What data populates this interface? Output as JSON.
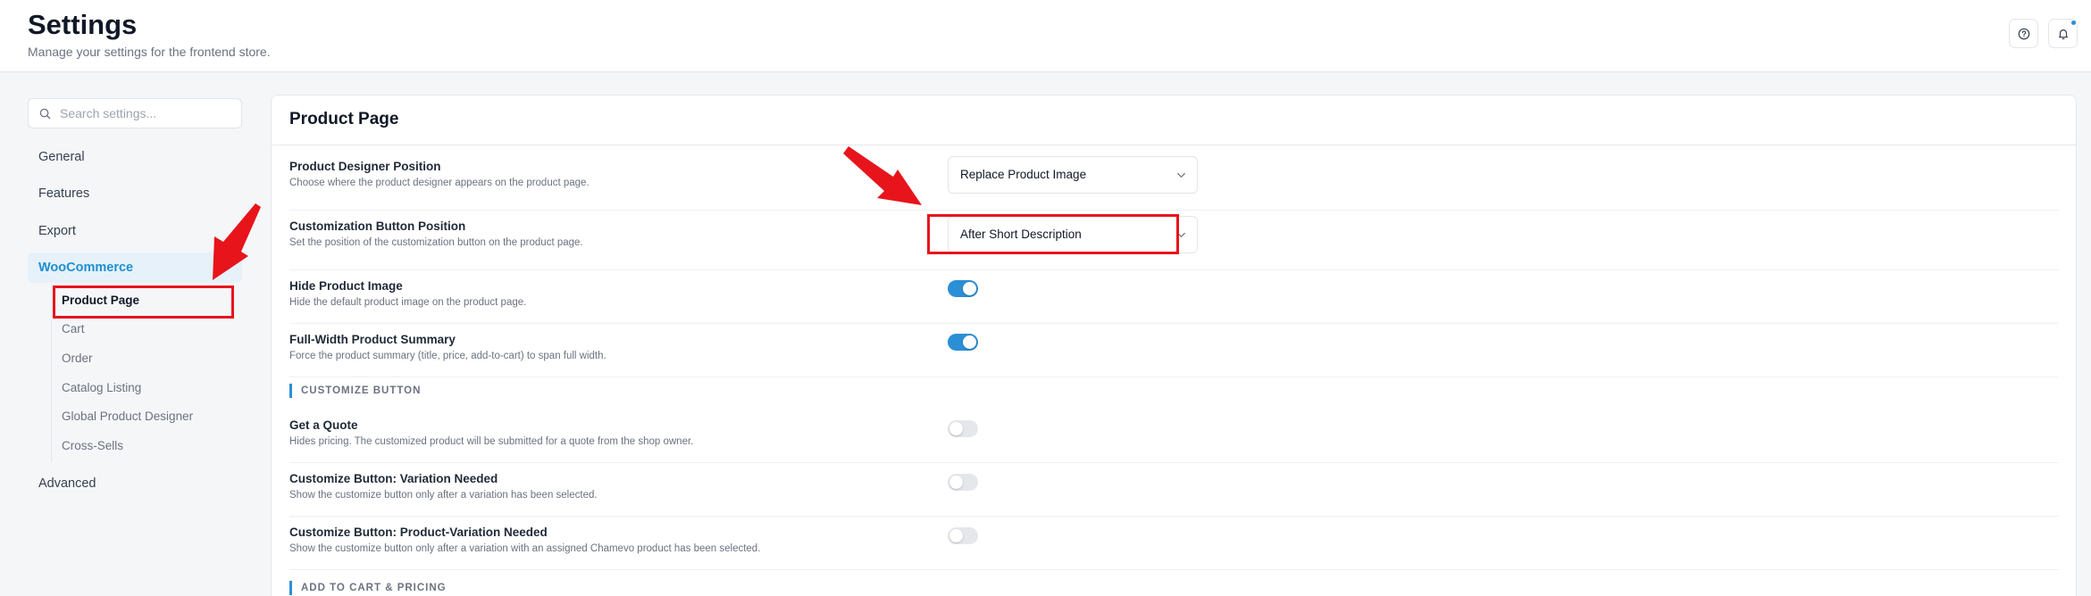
{
  "header": {
    "title": "Settings",
    "subtitle": "Manage your settings for the frontend store."
  },
  "sidebar": {
    "search_placeholder": "Search settings...",
    "items": [
      {
        "label": "General"
      },
      {
        "label": "Features"
      },
      {
        "label": "Export"
      },
      {
        "label": "WooCommerce"
      },
      {
        "label": "Advanced"
      }
    ],
    "woocommerce_subitems": [
      {
        "label": "Product Page"
      },
      {
        "label": "Cart"
      },
      {
        "label": "Order"
      },
      {
        "label": "Catalog Listing"
      },
      {
        "label": "Global Product Designer"
      },
      {
        "label": "Cross-Sells"
      }
    ]
  },
  "main": {
    "title": "Product Page",
    "settings": [
      {
        "title": "Product Designer Position",
        "desc": "Choose where the product designer appears on the product page.",
        "control": "select",
        "value": "Replace Product Image"
      },
      {
        "title": "Customization Button Position",
        "desc": "Set the position of the customization button on the product page.",
        "control": "select",
        "value": "After Short Description"
      },
      {
        "title": "Hide Product Image",
        "desc": "Hide the default product image on the product page.",
        "control": "toggle",
        "on": true
      },
      {
        "title": "Full-Width Product Summary",
        "desc": "Force the product summary (title, price, add-to-cart) to span full width.",
        "control": "toggle",
        "on": true
      }
    ],
    "section_customize": "CUSTOMIZE BUTTON",
    "customize_settings": [
      {
        "title": "Get a Quote",
        "desc": "Hides pricing. The customized product will be submitted for a quote from the shop owner.",
        "control": "toggle",
        "on": false
      },
      {
        "title": "Customize Button: Variation Needed",
        "desc": "Show the customize button only after a variation has been selected.",
        "control": "toggle",
        "on": false
      },
      {
        "title": "Customize Button: Product-Variation Needed",
        "desc": "Show the customize button only after a variation with an assigned Chamevo product has been selected.",
        "control": "toggle",
        "on": false
      }
    ],
    "section_cart": "ADD TO CART & PRICING"
  },
  "colors": {
    "accent": "#2b8fd6",
    "annotation_red": "#e8141c"
  },
  "icons": {
    "search": "search-icon",
    "help": "help-circle-icon",
    "bell": "bell-icon",
    "chevron": "chevron-down-icon"
  }
}
